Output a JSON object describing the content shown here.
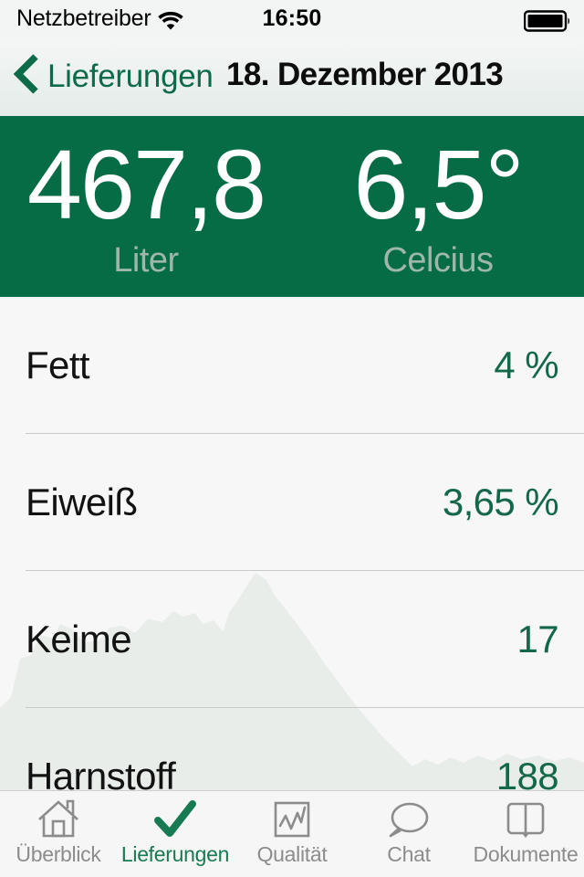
{
  "status_bar": {
    "carrier": "Netzbetreiber",
    "wifi_icon": "wifi-icon",
    "time": "16:50",
    "battery_icon": "battery-full-icon"
  },
  "nav_bar": {
    "back_icon": "chevron-left-icon",
    "back_label": "Lieferungen",
    "title": "18. Dezember 2013"
  },
  "summary": {
    "metrics": [
      {
        "value": "467,8",
        "unit": "Liter"
      },
      {
        "value": "6,5°",
        "unit": "Celcius"
      }
    ]
  },
  "list": {
    "rows": [
      {
        "label": "Fett",
        "value": "4 %"
      },
      {
        "label": "Eiweiß",
        "value": "3,65 %"
      },
      {
        "label": "Keime",
        "value": "17"
      },
      {
        "label": "Harnstoff",
        "value": "188"
      }
    ]
  },
  "tab_bar": {
    "tabs": [
      {
        "label": "Überblick",
        "icon": "house-icon",
        "active": false
      },
      {
        "label": "Lieferungen",
        "icon": "checkmark-icon",
        "active": true
      },
      {
        "label": "Qualität",
        "icon": "line-chart-icon",
        "active": false
      },
      {
        "label": "Chat",
        "icon": "speech-bubble-icon",
        "active": false
      },
      {
        "label": "Dokumente",
        "icon": "open-book-icon",
        "active": false
      }
    ]
  },
  "colors": {
    "brand_green": "#066C45",
    "value_green": "#14684A",
    "link_green": "#0C6B48",
    "active_tab_green": "#187A53",
    "inactive_tab_gray": "#8C8C8C",
    "background": "#F7F7F7"
  }
}
